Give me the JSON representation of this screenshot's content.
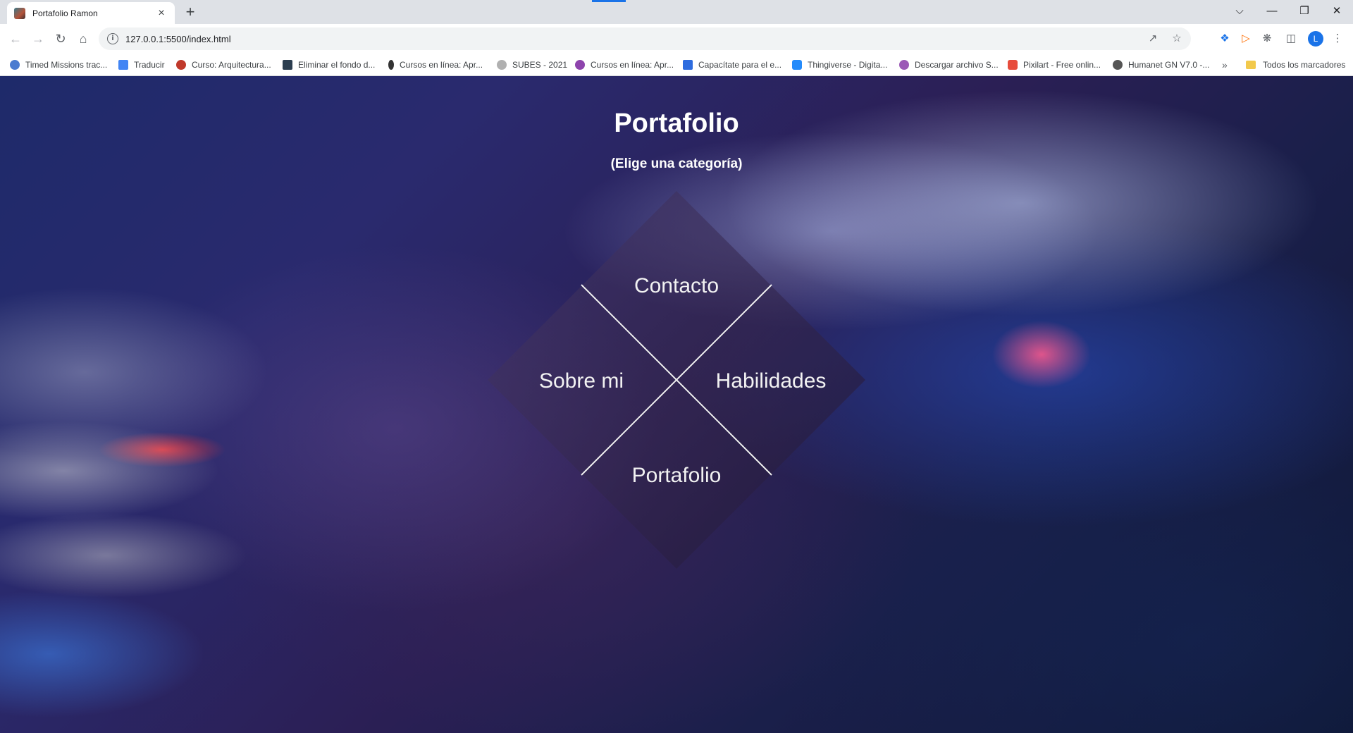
{
  "browser": {
    "tab_title": "Portafolio Ramon",
    "new_tab": "+",
    "close_tab": "×",
    "url": "127.0.0.1:5500/index.html",
    "avatar_letter": "L",
    "controls": {
      "minimize": "—",
      "restore": "❐",
      "close": "✕",
      "tab_list": "⌵"
    },
    "icons": [
      "back-icon",
      "forward-icon",
      "reload-icon",
      "home-icon",
      "info-icon",
      "share-icon",
      "star-icon",
      "extension-icon",
      "sidepanel-icon",
      "menu-icon"
    ]
  },
  "bookmarks": {
    "items": [
      {
        "label": "Timed Missions trac...",
        "color": "#4a7bd0"
      },
      {
        "label": "Traducir",
        "color": "#4285f4"
      },
      {
        "label": "Curso: Arquitectura...",
        "color": "#c0392b"
      },
      {
        "label": "Eliminar el fondo d...",
        "color": "#2c3e50"
      },
      {
        "label": "Cursos en línea: Apr...",
        "color": "#333333"
      },
      {
        "label": "SUBES - 2021",
        "color": "#b0b0b0"
      },
      {
        "label": "Cursos en línea: Apr...",
        "color": "#8e44ad"
      },
      {
        "label": "Capacítate para el e...",
        "color": "#2d6cdf"
      },
      {
        "label": "Thingiverse - Digita...",
        "color": "#248bfb"
      },
      {
        "label": "Descargar archivo S...",
        "color": "#9b59b6"
      },
      {
        "label": "Pixilart - Free onlin...",
        "color": "#e74c3c"
      },
      {
        "label": "Humanet GN V7.0 -...",
        "color": "#555555"
      }
    ],
    "overflow": "»",
    "all_bookmarks": "Todos los marcadores"
  },
  "page": {
    "title": "Portafolio",
    "subtitle": "(Elige una categoría)",
    "categories": {
      "top": "Contacto",
      "left": "Sobre mi",
      "right": "Habilidades",
      "bottom": "Portafolio"
    }
  },
  "colors": {
    "overlay": "#2a1f45",
    "text": "#ffffff",
    "accent": "#1a73e8"
  }
}
